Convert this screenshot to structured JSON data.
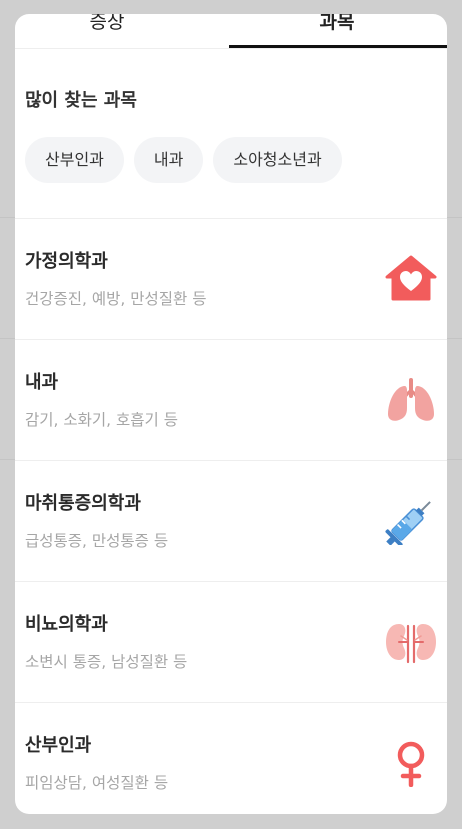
{
  "tabs": [
    {
      "label": "증상"
    },
    {
      "label": "과목"
    }
  ],
  "popular": {
    "title": "많이 찾는 과목",
    "chips": [
      "산부인과",
      "내과",
      "소아청소년과"
    ]
  },
  "departments": [
    {
      "name": "가정의학과",
      "desc": "건강증진, 예방, 만성질환 등",
      "icon": "house-heart-icon"
    },
    {
      "name": "내과",
      "desc": "감기, 소화기, 호흡기 등",
      "icon": "lungs-icon"
    },
    {
      "name": "마취통증의학과",
      "desc": "급성통증, 만성통증 등",
      "icon": "syringe-icon"
    },
    {
      "name": "비뇨의학과",
      "desc": "소변시 통증, 남성질환 등",
      "icon": "kidneys-icon"
    },
    {
      "name": "산부인과",
      "desc": "피임상담, 여성질환 등",
      "icon": "female-symbol-icon"
    }
  ],
  "colors": {
    "accent_red": "#f25c5c",
    "lung_pink": "#f2a3a0",
    "syringe_blue": "#5aa8e8",
    "kidney_pink": "#f7b8b4",
    "tab_indicator": "#111111"
  }
}
